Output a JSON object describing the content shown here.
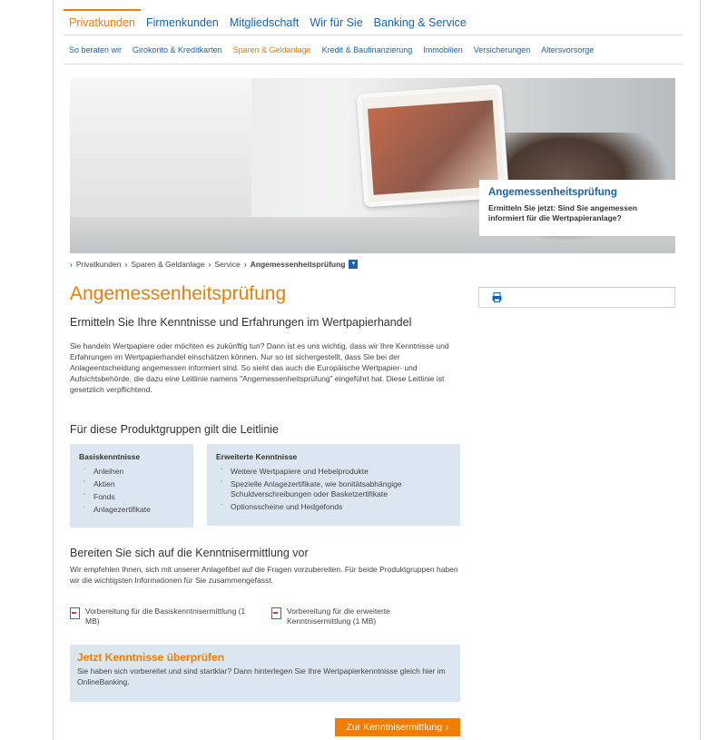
{
  "topnav": [
    {
      "label": "Privatkunden",
      "active": true
    },
    {
      "label": "Firmenkunden"
    },
    {
      "label": "Mitgliedschaft"
    },
    {
      "label": "Wir für Sie"
    },
    {
      "label": "Banking & Service"
    }
  ],
  "subnav": [
    {
      "label": "So beraten wir"
    },
    {
      "label": "Girokonto & Kreditkarten"
    },
    {
      "label": "Sparen & Geldanlage",
      "active": true
    },
    {
      "label": "Kredit & Baufinanzierung"
    },
    {
      "label": "Immobilien"
    },
    {
      "label": "Versicherungen"
    },
    {
      "label": "Altersvorsorge"
    }
  ],
  "hero": {
    "title": "Angemessenheitsprüfung",
    "text": "Ermitteln Sie jetzt: Sind Sie angemessen informiert für die Wertpapieranlage?"
  },
  "breadcrumb": [
    "Privatkunden",
    "Sparen & Geldanlage",
    "Service",
    "Angemessenheitsprüfung"
  ],
  "page_title": "Angemessenheitsprüfung",
  "section1": {
    "heading": "Ermitteln Sie Ihre Kenntnisse und Erfahrungen im Wertpapierhandel",
    "text": "Sie handeln Wertpapiere oder möchten es zukünftig tun? Dann ist es uns wichtig, dass wir Ihre Kenntnisse und Erfahrungen im Wertpapierhandel einschätzen können. Nur so ist sichergestellt, dass Sie bei der Anlageentscheidung angemessen informiert sind. So sieht das auch die Europäische Wertpapier- und Aufsichtsbehörde, die dazu eine Leitlinie namens \"Angemessenheitsprüfung\" eingeführt hat. Diese Leitlinie ist gesetzlich verpflichtend."
  },
  "section2": {
    "heading": "Für diese Produktgruppen gilt die Leitlinie",
    "basis": {
      "title": "Basiskenntnisse",
      "items": [
        "Anleihen",
        "Aktien",
        "Fonds",
        "Anlagezertifikate"
      ]
    },
    "erweitert": {
      "title": "Erweiterte Kenntnisse",
      "items": [
        "Weitere Wertpapiere und Hebelprodukte",
        "Spezielle Anlagezertifikate, wie bonitätsabhängige Schuldverschreibungen oder Basketzertifikate",
        "Optionsscheine und Hedgefonds"
      ]
    }
  },
  "section3": {
    "heading": "Bereiten Sie sich auf die Kenntnisermittlung vor",
    "text": "Wir empfehlen Ihnen, sich mit unserer Anlagefibel auf die Fragen vorzubereiten. Für beide Produktgruppen haben wir die wichtigsten Informationen für Sie zusammengefasst.",
    "downloads": [
      "Vorbereitung für die Basiskenntnisermittlung (1 MB)",
      "Vorbereitung für die erweiterte Kenntnisermittlung (1 MB)"
    ]
  },
  "cta": {
    "title": "Jetzt Kenntnisse überprüfen",
    "text": "Sie haben sich vorbereitet und sind startklar? Dann hinterlegen Sie Ihre Wertpapierkenntnisse gleich hier im OnlineBanking.",
    "button": "Zur Kenntnisermittlung",
    "button_icon": "›"
  },
  "colors": {
    "accent": "#ef7d00",
    "primary": "#1a63a8",
    "box": "#dbe6f1"
  }
}
